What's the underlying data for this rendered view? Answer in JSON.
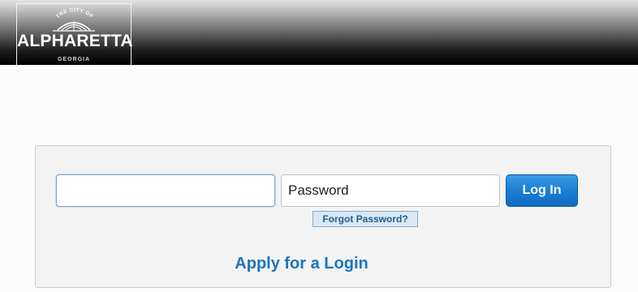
{
  "header": {
    "logo": {
      "arc_text": "THE CITY OF",
      "city_name": "ALPHARETTA",
      "state": "GEORGIA"
    }
  },
  "login": {
    "username": {
      "value": "",
      "placeholder": ""
    },
    "password": {
      "value": "",
      "placeholder": "Password"
    },
    "login_button_label": "Log In",
    "forgot_password_label": "Forgot Password?",
    "apply_label": "Apply for a Login"
  },
  "colors": {
    "accent_blue": "#1b75bb",
    "button_blue": "#1a7fd6",
    "header_black": "#000000"
  }
}
